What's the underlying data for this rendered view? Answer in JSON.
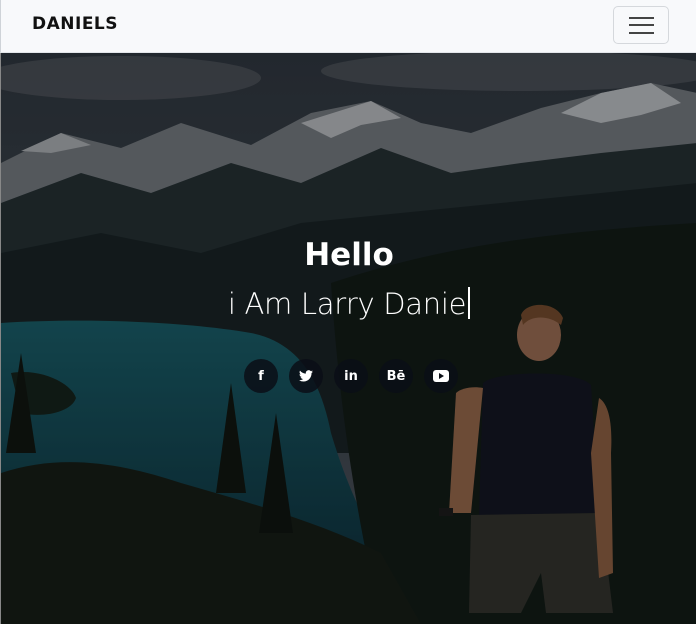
{
  "navbar": {
    "brand": "DANIELS",
    "toggle_icon": "hamburger-menu-icon"
  },
  "hero": {
    "greeting": "Hello",
    "subtitle": "i Am Larry Danie",
    "socials": [
      {
        "icon": "facebook-icon",
        "glyph": "f"
      },
      {
        "icon": "twitter-icon",
        "glyph": "t"
      },
      {
        "icon": "linkedin-icon",
        "glyph": "in"
      },
      {
        "icon": "behance-icon",
        "glyph": "Bē"
      },
      {
        "icon": "youtube-icon",
        "glyph": "▶"
      }
    ]
  }
}
